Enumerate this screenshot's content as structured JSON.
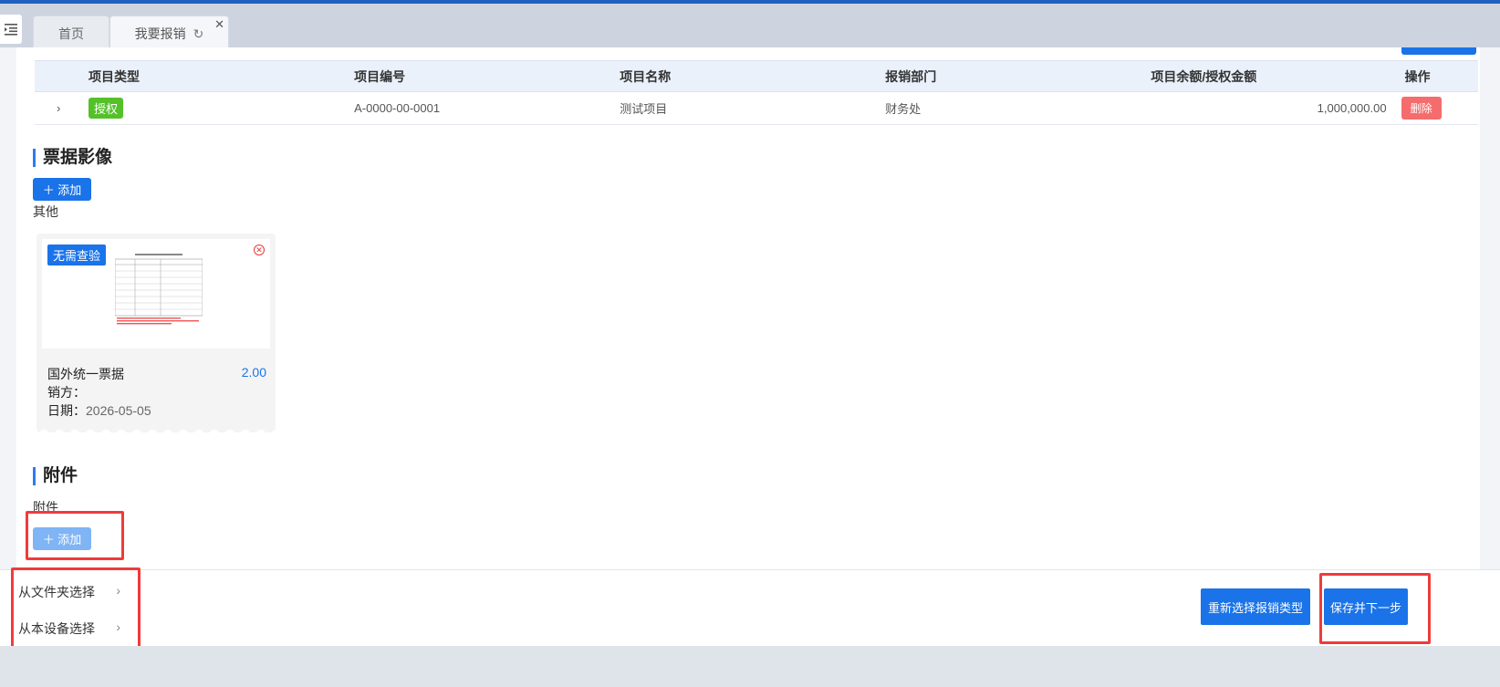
{
  "tabs": {
    "home": "首页",
    "active": "我要报销"
  },
  "project_table": {
    "headers": [
      "项目类型",
      "项目编号",
      "项目名称",
      "报销部门",
      "项目余额/授权金额",
      "操作"
    ],
    "row": {
      "type_tag": "授权",
      "code": "A-0000-00-0001",
      "name": "测试项目",
      "department": "财务处",
      "balance": "1,000,000.00",
      "action": "删除"
    }
  },
  "receipt_section": {
    "title": "票据影像",
    "add_label": "＋ 添加",
    "category": "其他",
    "card": {
      "badge": "无需查验",
      "name": "国外统一票据",
      "amount": "2.00",
      "seller_label": "销方：",
      "date_label": "日期：",
      "date_value": "2026-05-05"
    }
  },
  "attachment_section": {
    "title": "附件",
    "category": "附件",
    "add_label": "＋ 添加"
  },
  "popup_menu": {
    "items": [
      "从文件夹选择",
      "从本设备选择"
    ]
  },
  "footer": {
    "reselect_label": "重新选择报销类型",
    "save_next_label": "保存并下一步"
  },
  "colors": {
    "primary": "#1a73e8",
    "tag_green": "#55c12a",
    "danger": "#f56c6c",
    "highlight": "#ef3b3b"
  }
}
